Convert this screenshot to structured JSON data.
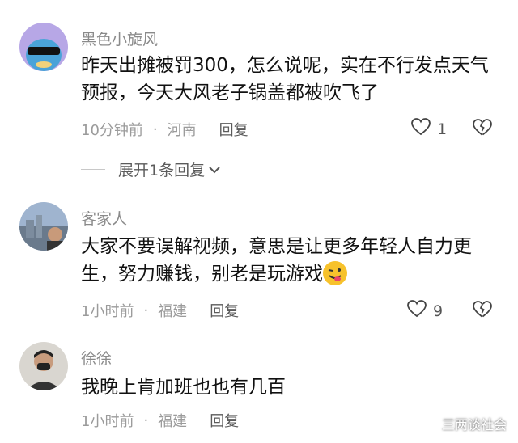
{
  "comments": [
    {
      "username": "黑色小旋风",
      "text": "昨天出摊被罚300，怎么说呢，实在不行发点天气预报，今天大风老子锅盖都被吹飞了",
      "time": "10分钟前",
      "location": "河南",
      "reply_label": "回复",
      "likes": "1",
      "expand_label": "展开1条回复"
    },
    {
      "username": "客家人",
      "text": "大家不要误解视频，意思是让更多年轻人自力更生，努力赚钱，别老是玩游戏",
      "emoji": "winking-tongue-emoji",
      "time": "1小时前",
      "location": "福建",
      "reply_label": "回复",
      "likes": "9"
    },
    {
      "username": "徐徐",
      "text": "我晚上肯加班也也有几百",
      "time": "1小时前",
      "location": "福建",
      "reply_label": "回复"
    }
  ],
  "separator": "·",
  "watermark": "三两谈社会",
  "colors": {
    "name": "#8a8a8a",
    "text": "#111111",
    "meta": "#9b9b9b"
  }
}
